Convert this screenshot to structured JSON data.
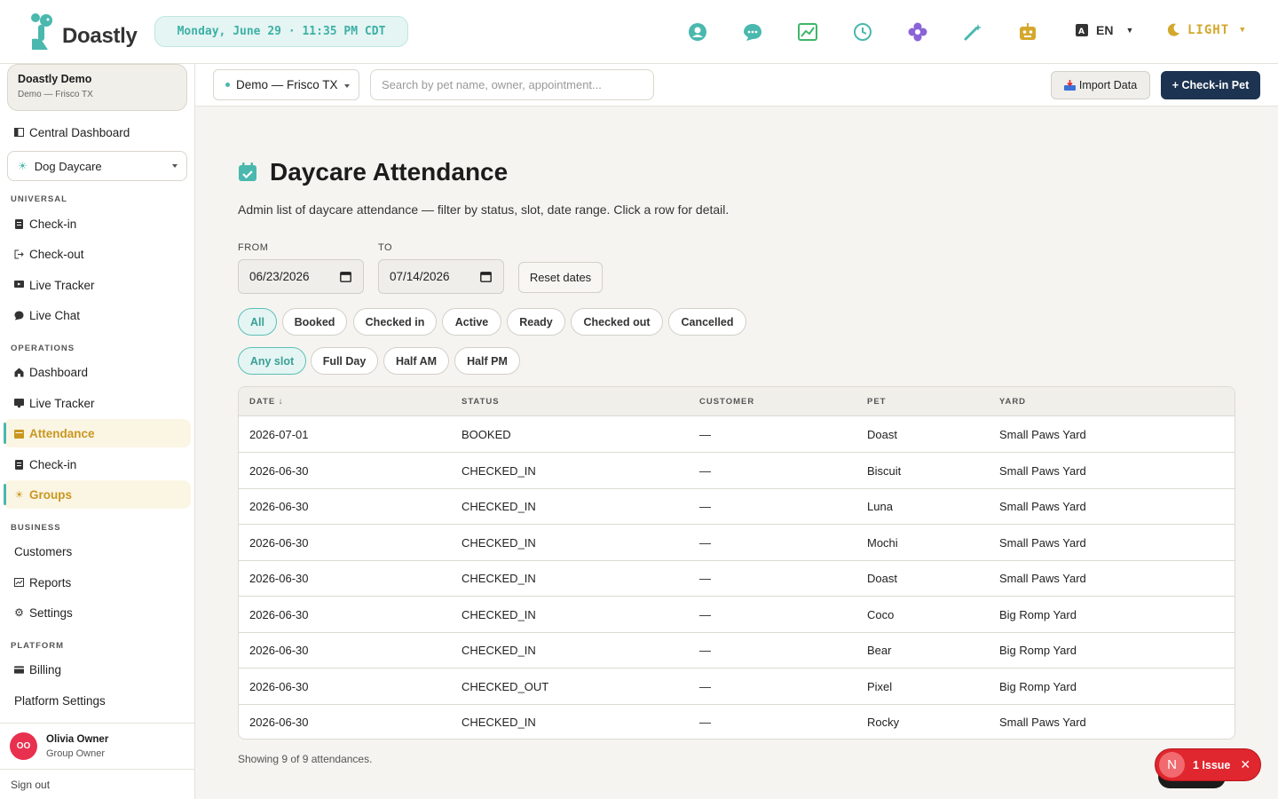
{
  "app": {
    "brand": "Doastly",
    "datetime": "Monday, June 29 · 11:35 PM CDT",
    "language": "EN",
    "theme": "LIGHT",
    "colors": {
      "accent": "#4ab8ae",
      "gold": "#c9971f",
      "navy": "#1c3351",
      "danger": "#e0262e"
    }
  },
  "toolbar_icons": [
    "support-icon",
    "chat-icon",
    "analytics-icon",
    "history-icon",
    "flower-icon",
    "magic-wand-icon",
    "robot-icon"
  ],
  "sidebar": {
    "org_name": "Doastly Demo",
    "org_sub": "Demo — Frisco TX",
    "central": "Central Dashboard",
    "module": "Dog Daycare",
    "sections": {
      "universal": "UNIVERSAL",
      "operations": "OPERATIONS",
      "business": "BUSINESS",
      "platform": "PLATFORM"
    },
    "universal_items": [
      "Check-in",
      "Check-out",
      "Live Tracker",
      "Live Chat"
    ],
    "operations_items": [
      "Dashboard",
      "Live Tracker",
      "Attendance",
      "Check-in",
      "Groups"
    ],
    "business_items": [
      "Customers",
      "Reports",
      "Settings"
    ],
    "platform_items": [
      "Billing",
      "Platform Settings"
    ],
    "user": {
      "initials": "OO",
      "name": "Olivia Owner",
      "role": "Group Owner"
    },
    "signout": "Sign out"
  },
  "subbar": {
    "location": "Demo — Frisco TX",
    "search_placeholder": "Search by pet name, owner, appointment...",
    "import_label": "Import Data",
    "checkin_label": "+ Check-in Pet"
  },
  "main": {
    "title": "Daycare Attendance",
    "description": "Admin list of daycare attendance — filter by status, slot, date range. Click a row for detail.",
    "from_label": "FROM",
    "to_label": "TO",
    "from_value": "06/23/2026",
    "to_value": "07/14/2026",
    "reset_label": "Reset dates",
    "status_filters": [
      "All",
      "Booked",
      "Checked in",
      "Active",
      "Ready",
      "Checked out",
      "Cancelled"
    ],
    "slot_filters": [
      "Any slot",
      "Full Day",
      "Half AM",
      "Half PM"
    ],
    "columns": {
      "date": "DATE ↓",
      "status": "STATUS",
      "customer": "CUSTOMER",
      "pet": "PET",
      "yard": "YARD"
    },
    "rows": [
      {
        "date": "2026-07-01",
        "status": "BOOKED",
        "customer": "—",
        "pet": "Doast",
        "yard": "Small Paws Yard"
      },
      {
        "date": "2026-06-30",
        "status": "CHECKED_IN",
        "customer": "—",
        "pet": "Biscuit",
        "yard": "Small Paws Yard"
      },
      {
        "date": "2026-06-30",
        "status": "CHECKED_IN",
        "customer": "—",
        "pet": "Luna",
        "yard": "Small Paws Yard"
      },
      {
        "date": "2026-06-30",
        "status": "CHECKED_IN",
        "customer": "—",
        "pet": "Mochi",
        "yard": "Small Paws Yard"
      },
      {
        "date": "2026-06-30",
        "status": "CHECKED_IN",
        "customer": "—",
        "pet": "Doast",
        "yard": "Small Paws Yard"
      },
      {
        "date": "2026-06-30",
        "status": "CHECKED_IN",
        "customer": "—",
        "pet": "Coco",
        "yard": "Big Romp Yard"
      },
      {
        "date": "2026-06-30",
        "status": "CHECKED_IN",
        "customer": "—",
        "pet": "Bear",
        "yard": "Big Romp Yard"
      },
      {
        "date": "2026-06-30",
        "status": "CHECKED_OUT",
        "customer": "—",
        "pet": "Pixel",
        "yard": "Big Romp Yard"
      },
      {
        "date": "2026-06-30",
        "status": "CHECKED_IN",
        "customer": "—",
        "pet": "Rocky",
        "yard": "Small Paws Yard"
      }
    ],
    "showing": "Showing 9 of 9 attendances."
  },
  "issue_badge": {
    "letter": "N",
    "label": "1 Issue"
  }
}
